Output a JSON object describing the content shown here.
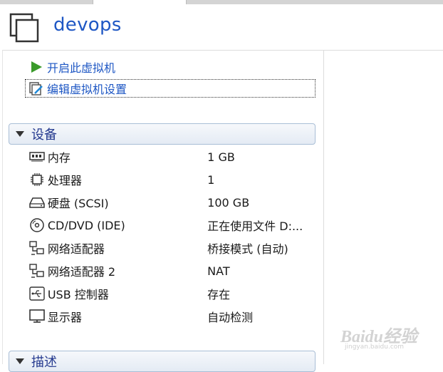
{
  "vm": {
    "title": "devops"
  },
  "actions": {
    "power_on": "开启此虚拟机",
    "edit_settings": "编辑虚拟机设置"
  },
  "devices_section": {
    "title": "设备",
    "items": [
      {
        "icon": "memory-icon",
        "name": "内存",
        "value": "1 GB"
      },
      {
        "icon": "processor-icon",
        "name": "处理器",
        "value": "1"
      },
      {
        "icon": "hard-disk-icon",
        "name": "硬盘 (SCSI)",
        "value": "100 GB"
      },
      {
        "icon": "cd-dvd-icon",
        "name": "CD/DVD (IDE)",
        "value": "正在使用文件 D:..."
      },
      {
        "icon": "network-adapter-icon",
        "name": "网络适配器",
        "value": "桥接模式 (自动)"
      },
      {
        "icon": "network-adapter-icon",
        "name": "网络适配器 2",
        "value": "NAT"
      },
      {
        "icon": "usb-icon",
        "name": "USB 控制器",
        "value": "存在"
      },
      {
        "icon": "display-icon",
        "name": "显示器",
        "value": "自动检测"
      }
    ]
  },
  "description_section": {
    "title": "描述"
  },
  "watermark": {
    "brand": "Baidu经验",
    "url": "jingyan.baidu.com"
  },
  "colors": {
    "accent": "#1e57c4",
    "play_green": "#3a9a2a"
  }
}
